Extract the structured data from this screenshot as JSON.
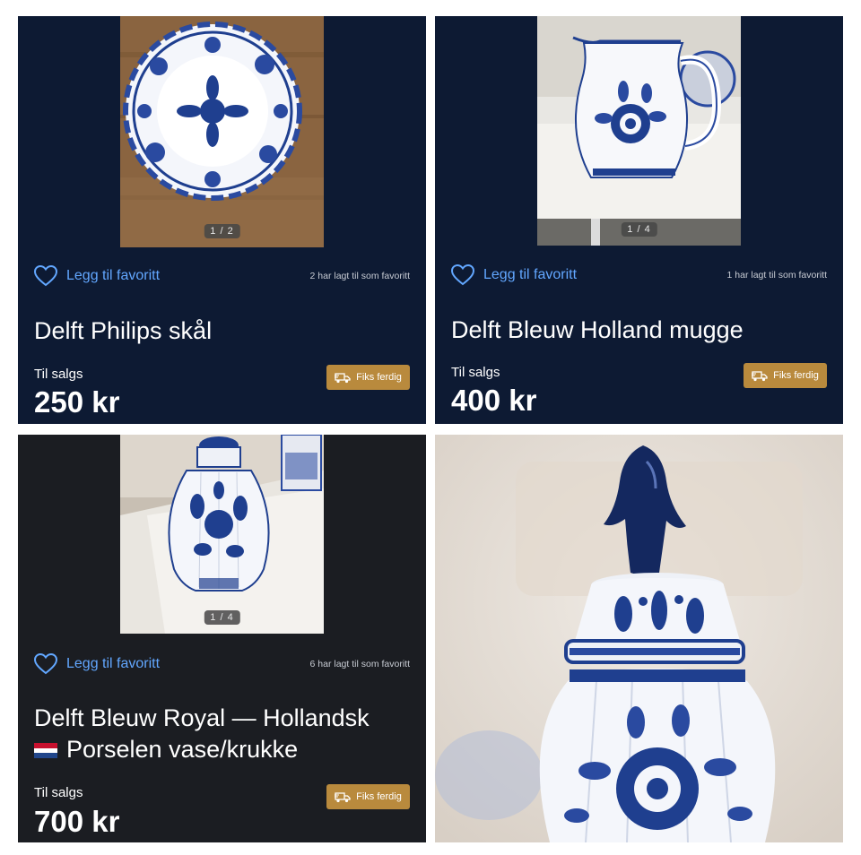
{
  "listings": [
    {
      "image_counter": "1 / 2",
      "favorite_label": "Legg til favoritt",
      "favorite_count": "2 har lagt til som favoritt",
      "title": "Delft Philips skål",
      "status": "Til salgs",
      "price": "250 kr",
      "badge": "Fiks ferdig"
    },
    {
      "image_counter": "1 / 4",
      "favorite_label": "Legg til favoritt",
      "favorite_count": "1 har lagt til som favoritt",
      "title": "Delft Bleuw Holland mugge",
      "status": "Til salgs",
      "price": "400 kr",
      "badge": "Fiks ferdig"
    },
    {
      "image_counter": "1 / 4",
      "favorite_label": "Legg til favoritt",
      "favorite_count": "6 har lagt til som favoritt",
      "title_line1": "Delft Bleuw Royal — Hollandsk",
      "title_line2": "Porselen vase/krukke",
      "status": "Til salgs",
      "price": "700 kr",
      "badge": "Fiks ferdig"
    }
  ],
  "icons": {
    "favorite": "heart-outline-icon",
    "badge": "delivery-truck-icon",
    "flag": "netherlands-flag-icon"
  },
  "colors": {
    "card_navy": "#0d1a33",
    "card_dark": "#1b1d22",
    "link_blue": "#62a7ff",
    "badge_gold": "#b98a3d",
    "delft_blue": "#1f3f8f"
  }
}
